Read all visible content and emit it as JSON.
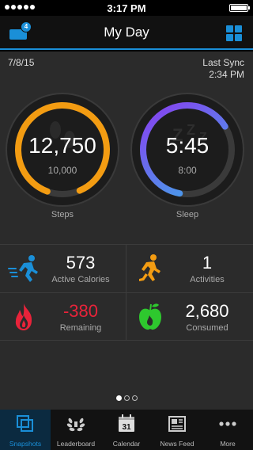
{
  "status_bar": {
    "time": "3:17 PM"
  },
  "nav": {
    "title": "My Day",
    "inbox_badge": "4"
  },
  "summary": {
    "date": "7/8/15",
    "sync_label": "Last Sync",
    "sync_time": "2:34 PM"
  },
  "gauges": {
    "steps": {
      "value": "12,750",
      "goal": "10,000",
      "label": "Steps",
      "progress": 1.0,
      "color": "#f39c12"
    },
    "sleep": {
      "value": "5:45",
      "goal": "8:00",
      "label": "Sleep",
      "progress": 0.72,
      "color": "#8a3cf0",
      "accent": "#3ab0e8"
    }
  },
  "tiles": {
    "active_calories": {
      "value": "573",
      "label": "Active Calories",
      "icon": "running-figure-icon",
      "color": "#1a8fd8"
    },
    "activities": {
      "value": "1",
      "label": "Activities",
      "icon": "running-figure-icon",
      "color": "#f39c12"
    },
    "remaining": {
      "value": "-380",
      "label": "Remaining",
      "icon": "flame-icon",
      "color": "#e8233a"
    },
    "consumed": {
      "value": "2,680",
      "label": "Consumed",
      "icon": "apple-icon",
      "color": "#2ec82e"
    }
  },
  "pager": {
    "pages": 3,
    "current": 1
  },
  "tabbar": {
    "tabs": [
      {
        "label": "Snapshots",
        "icon": "snapshots-icon",
        "active": true
      },
      {
        "label": "Leaderboard",
        "icon": "laurel-wreath-icon",
        "active": false
      },
      {
        "label": "Calendar",
        "icon": "calendar-icon",
        "active": false,
        "calendar_day": "31"
      },
      {
        "label": "News Feed",
        "icon": "newspaper-icon",
        "active": false
      },
      {
        "label": "More",
        "icon": "more-dots-icon",
        "active": false
      }
    ]
  }
}
